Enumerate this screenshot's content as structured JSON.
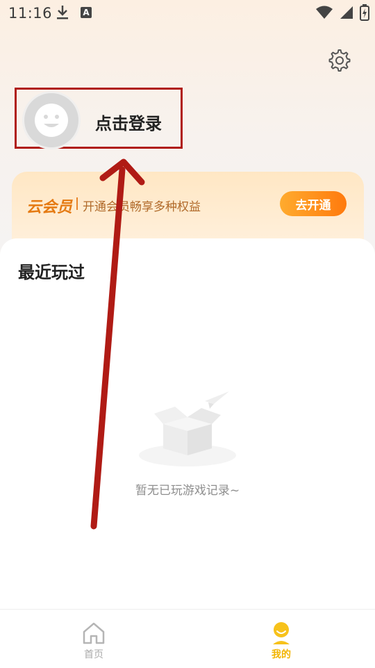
{
  "status_bar": {
    "time": "11:16"
  },
  "profile": {
    "login_label": "点击登录"
  },
  "vip": {
    "title": "云会员",
    "description": "开通会员畅享多种权益",
    "button_label": "去开通"
  },
  "recent": {
    "title": "最近玩过",
    "empty_text": "暂无已玩游戏记录~"
  },
  "bottom_nav": {
    "items": [
      {
        "label": "首页",
        "icon": "home-icon",
        "active": false
      },
      {
        "label": "我的",
        "icon": "mine-icon",
        "active": true
      }
    ]
  },
  "colors": {
    "accent": "#f2b400",
    "vip_orange": "#ff8a1a",
    "annotation_red": "#b01b15"
  }
}
